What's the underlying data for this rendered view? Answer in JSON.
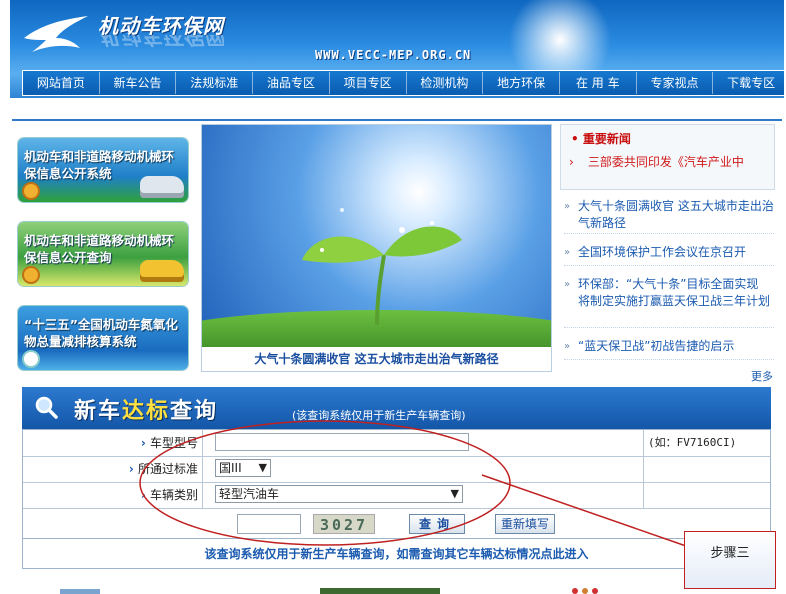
{
  "header": {
    "site_name": "机动车环保网",
    "site_url": "WWW.VECC-MEP.ORG.CN",
    "nav": [
      "网站首页",
      "新车公告",
      "法规标准",
      "油品专区",
      "项目专区",
      "检测机构",
      "地方环保",
      "在 用 车",
      "专家视点",
      "下载专区"
    ]
  },
  "banners": [
    {
      "text": "机动车和非道路移动机械环保信息公开系统"
    },
    {
      "text": "机动车和非道路移动机械环保信息公开查询"
    },
    {
      "text": "“十三五”全国机动车氮氧化物总量减排核算系统"
    }
  ],
  "photo": {
    "caption": "大气十条圆满收官 这五大城市走出治气新路径"
  },
  "news": {
    "header_title": "重要新闻",
    "headline": "三部委共同印发《汽车产业中",
    "items": [
      "大气十条圆满收官 这五大城市走出治气新路径",
      "全国环境保护工作会议在京召开",
      "环保部：“大气十条”目标全面实现 将制定实施打赢蓝天保卫战三年计划",
      "“蓝天保卫战”初战告捷的启示"
    ],
    "more_label": "更多"
  },
  "query": {
    "title_prefix": "新车",
    "title_accent": "达标",
    "title_suffix": "查询",
    "note": "(该查询系统仅用于新生产车辆查询)",
    "fields": {
      "model_label": "车型型号",
      "model_value": "",
      "model_hint": "(如：FV7160CI)",
      "std_label": "所通过标准",
      "std_value": "国III",
      "type_label": "车辆类别",
      "type_value": "轻型汽油车"
    },
    "captcha_value": "",
    "captcha_text": "3027",
    "query_button": "查询",
    "reset_button": "重新填写",
    "other_link": "该查询系统仅用于新生产车辆查询，如需查询其它车辆达标情况点此进入"
  },
  "annotation": {
    "step_label": "步骤三",
    "color": "#c02020"
  }
}
